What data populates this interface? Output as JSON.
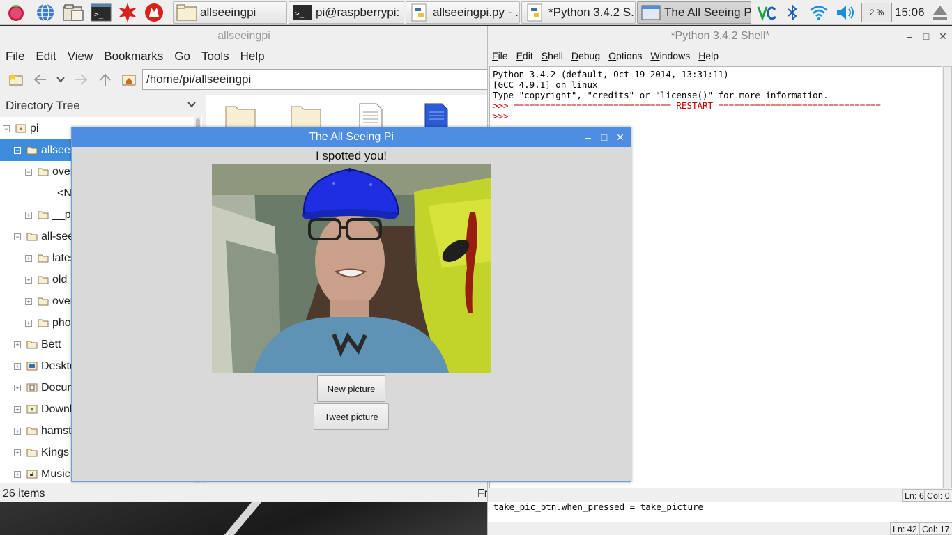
{
  "taskbar": {
    "launchers": [
      {
        "icon": "raspberry-menu-icon"
      },
      {
        "icon": "web-browser-icon"
      },
      {
        "icon": "file-manager-icon"
      },
      {
        "icon": "terminal-icon"
      },
      {
        "icon": "math-kernel-icon"
      },
      {
        "icon": "wolfram-icon"
      }
    ],
    "tasks": [
      {
        "label": "allseeingpi",
        "icon": "folder-icon",
        "active": false
      },
      {
        "label": "pi@raspberrypi: ...",
        "icon": "terminal-icon",
        "active": false
      },
      {
        "label": "allseeingpi.py - ...",
        "icon": "python-icon",
        "active": false
      },
      {
        "label": "*Python 3.4.2 S...",
        "icon": "python-icon",
        "active": false
      },
      {
        "label": "The All Seeing Pi",
        "icon": "window-icon",
        "active": true
      }
    ],
    "tray": [
      "vnc-icon",
      "bluetooth-icon",
      "wifi-icon",
      "volume-icon"
    ],
    "cpu_usage": "2 %",
    "clock": "15:06"
  },
  "file_manager": {
    "title": "allseeingpi",
    "menu": [
      "File",
      "Edit",
      "View",
      "Bookmarks",
      "Go",
      "Tools",
      "Help"
    ],
    "path": "/home/pi/allseeingpi",
    "tree_header": "Directory Tree",
    "tree": [
      {
        "label": "pi",
        "expander": "⊟",
        "indent": 0,
        "selected": false,
        "icon": "home-folder"
      },
      {
        "label": "allseeingpi",
        "expander": "⊟",
        "indent": 1,
        "selected": true,
        "icon": "folder"
      },
      {
        "label": "overlays",
        "expander": "⊟",
        "indent": 2,
        "selected": false,
        "icon": "folder"
      },
      {
        "label": "<No sub folders>",
        "expander": "",
        "indent": 3,
        "selected": false,
        "icon": ""
      },
      {
        "label": "__pycache__",
        "expander": "⊞",
        "indent": 2,
        "selected": false,
        "icon": "folder"
      },
      {
        "label": "all-seeing-pi",
        "expander": "⊟",
        "indent": 1,
        "selected": false,
        "icon": "folder"
      },
      {
        "label": "latest",
        "expander": "⊞",
        "indent": 2,
        "selected": false,
        "icon": "folder"
      },
      {
        "label": "old",
        "expander": "⊞",
        "indent": 2,
        "selected": false,
        "icon": "folder"
      },
      {
        "label": "overlays",
        "expander": "⊞",
        "indent": 2,
        "selected": false,
        "icon": "folder"
      },
      {
        "label": "photos",
        "expander": "⊞",
        "indent": 2,
        "selected": false,
        "icon": "folder"
      },
      {
        "label": "Bett",
        "expander": "⊞",
        "indent": 1,
        "selected": false,
        "icon": "folder"
      },
      {
        "label": "Desktop",
        "expander": "⊞",
        "indent": 1,
        "selected": false,
        "icon": "desktop-folder"
      },
      {
        "label": "Documents",
        "expander": "⊞",
        "indent": 1,
        "selected": false,
        "icon": "documents-folder"
      },
      {
        "label": "Downloads",
        "expander": "⊞",
        "indent": 1,
        "selected": false,
        "icon": "downloads-folder"
      },
      {
        "label": "hamster",
        "expander": "⊞",
        "indent": 1,
        "selected": false,
        "icon": "folder"
      },
      {
        "label": "Kings Fund",
        "expander": "⊞",
        "indent": 1,
        "selected": false,
        "icon": "folder"
      },
      {
        "label": "Music",
        "expander": "⊞",
        "indent": 1,
        "selected": false,
        "icon": "music-folder"
      }
    ],
    "files": [
      "folder-icon",
      "folder-icon",
      "text-file-icon",
      "python-file-icon"
    ],
    "status_left": "26 items",
    "status_right": "Fr"
  },
  "shell": {
    "title": "*Python 3.4.2 Shell*",
    "menu": [
      "File",
      "Edit",
      "Shell",
      "Debug",
      "Options",
      "Windows",
      "Help"
    ],
    "lines": [
      "Python 3.4.2 (default, Oct 19 2014, 13:31:11)",
      "[GCC 4.9.1] on linux",
      "Type \"copyright\", \"credits\" or \"license()\" for more information."
    ],
    "restart_line": ">>> ============================== RESTART ===============================",
    "prompt": ">>>",
    "status_ln": "Ln: 6",
    "status_col": "Col: 0",
    "editor_line": "take_pic_btn.when_pressed = take_picture",
    "editor_ln": "Ln: 42",
    "editor_col": "Col: 17"
  },
  "dialog": {
    "title": "The All Seeing Pi",
    "message": "I spotted you!",
    "new_picture": "New picture",
    "tweet_picture": "Tweet picture",
    "cap_color": "#1d2fe0"
  }
}
